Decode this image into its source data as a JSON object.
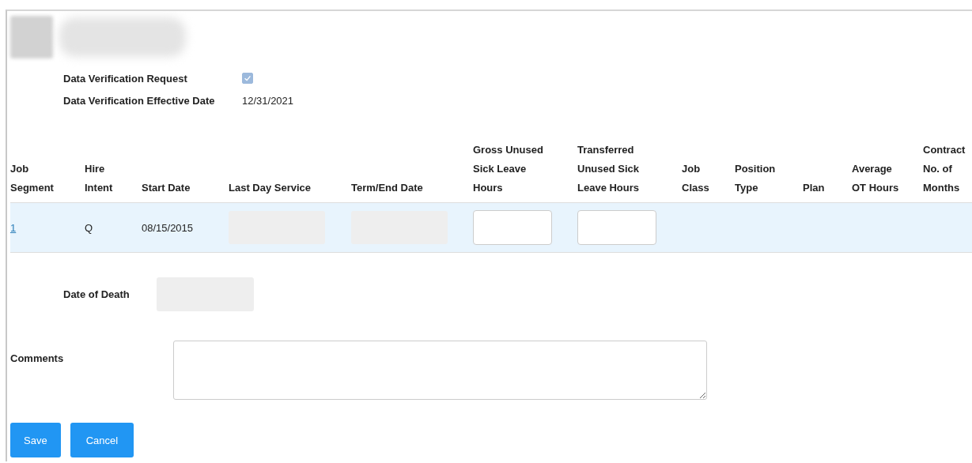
{
  "header": {
    "avatar": {
      "kind": "redacted"
    },
    "name": {
      "kind": "redacted"
    }
  },
  "fields": [
    {
      "label": "Data Verification Request",
      "kind": "checkbox",
      "checked": true,
      "disabled": true
    },
    {
      "label": "Data Verification Effective Date",
      "kind": "text",
      "value": "12/31/2021"
    }
  ],
  "table": {
    "columns": [
      "Job Segment",
      "Hire Intent",
      "Start Date",
      "Last Day Service",
      "Term/End Date",
      "Gross Unused Sick Leave Hours",
      "Transferred Unused Sick Leave Hours",
      "Job Class",
      "Position Type",
      "Plan",
      "Average OT Hours",
      "Contract No. of Months"
    ],
    "rows": [
      {
        "cells": [
          {
            "kind": "link",
            "text": "1"
          },
          {
            "kind": "text",
            "text": "Q"
          },
          {
            "kind": "text",
            "text": "08/15/2015"
          },
          {
            "kind": "disabled_field"
          },
          {
            "kind": "disabled_field"
          },
          {
            "kind": "input"
          },
          {
            "kind": "input"
          },
          {
            "kind": "empty"
          },
          {
            "kind": "empty"
          },
          {
            "kind": "empty"
          },
          {
            "kind": "empty"
          },
          {
            "kind": "empty"
          }
        ]
      }
    ]
  },
  "date_of_death": {
    "label": "Date of Death"
  },
  "comments": {
    "label": "Comments"
  },
  "buttons": [
    "Save",
    "Cancel"
  ]
}
